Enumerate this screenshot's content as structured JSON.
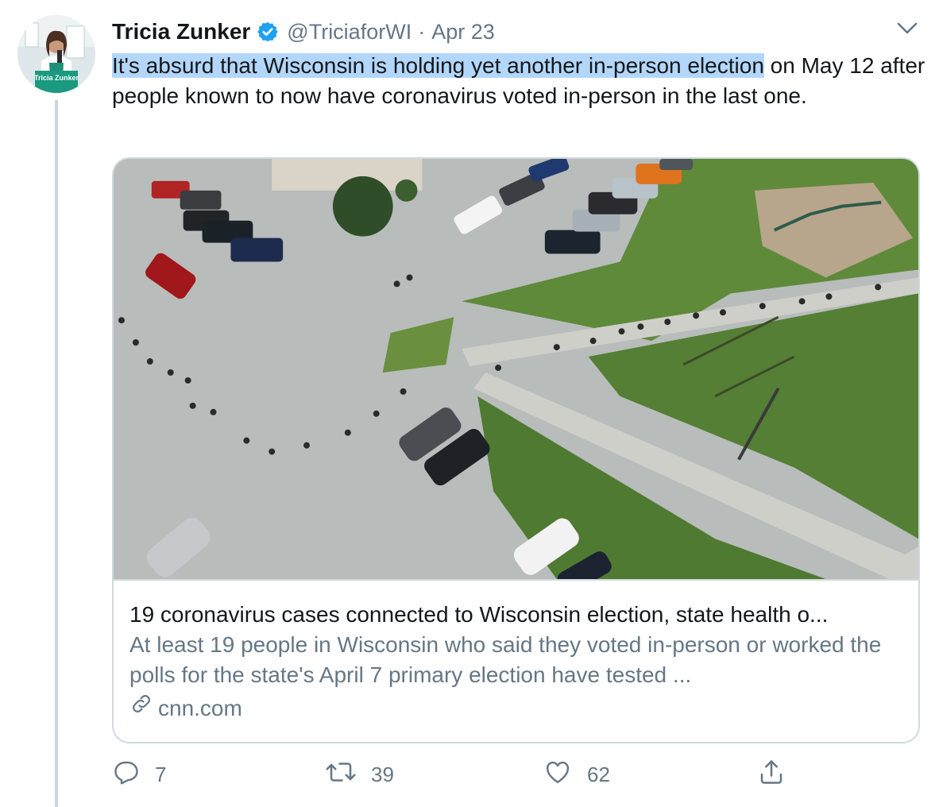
{
  "tweet": {
    "author_name": "Tricia Zunker",
    "handle": "@TriciaforWI",
    "separator": "·",
    "date": "Apr 23",
    "text_highlighted": "It's absurd that Wisconsin is holding yet another in-person election",
    "text_rest": " on May 12 after people known to now have coronavirus voted in-person in the last one.",
    "avatar_sign_text": "Tricia Zunker"
  },
  "card": {
    "title": "19 coronavirus cases connected to Wisconsin election, state health o...",
    "description": "At least 19 people in Wisconsin who said they voted in-person or worked the polls for the state's April 7 primary election have tested ...",
    "domain": "cnn.com"
  },
  "actions": {
    "reply_count": "7",
    "retweet_count": "39",
    "like_count": "62"
  },
  "colors": {
    "text": "#14171a",
    "muted": "#657786",
    "verified": "#1da1f2",
    "highlight": "#b3d7fb",
    "border": "#cfd9de",
    "thread_line": "#c9d6df"
  },
  "icons": [
    "verified-badge-icon",
    "chevron-down-icon",
    "link-icon",
    "reply-icon",
    "retweet-icon",
    "like-icon",
    "share-icon"
  ]
}
